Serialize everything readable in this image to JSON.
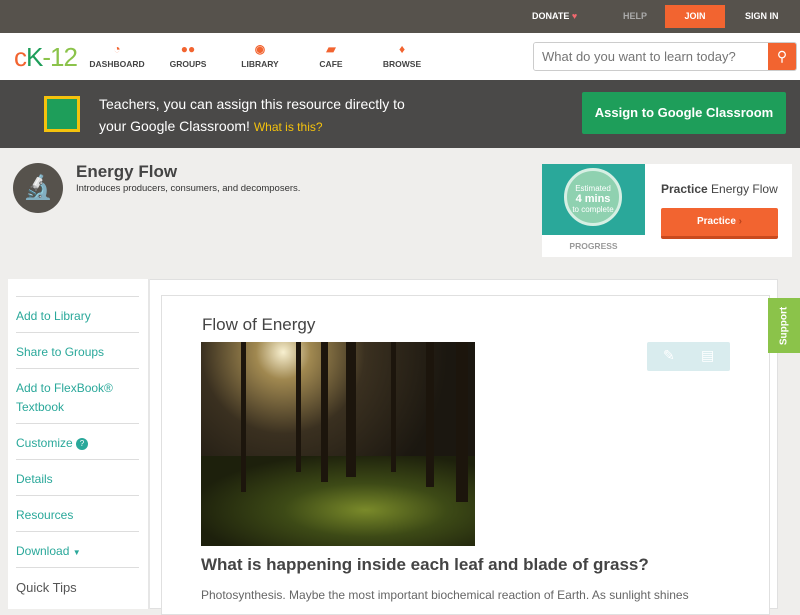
{
  "topbar": {
    "donate": "DONATE",
    "help": "HELP",
    "join": "JOIN",
    "signin": "SIGN IN"
  },
  "logo": {
    "text": "cK-12"
  },
  "nav": [
    {
      "label": "DASHBOARD",
      "icon": "dashboard-icon"
    },
    {
      "label": "GROUPS",
      "icon": "groups-icon"
    },
    {
      "label": "LIBRARY",
      "icon": "library-icon"
    },
    {
      "label": "CAFE",
      "icon": "cafe-icon"
    },
    {
      "label": "BROWSE",
      "icon": "browse-icon"
    }
  ],
  "search": {
    "placeholder": "What do you want to learn today?"
  },
  "banner": {
    "text": "Teachers, you can assign this resource directly to",
    "text2": "your Google Classroom!",
    "link": "What is this?",
    "button": "Assign to Google Classroom"
  },
  "header": {
    "title": "Energy Flow",
    "subtitle": "Introduces producers, consumers, and decomposers."
  },
  "practice": {
    "est1": "Estimated",
    "est2": "4 mins",
    "est3": "to complete",
    "progress": "PROGRESS",
    "bold": "Practice",
    "name": "Energy Flow",
    "button": "Practice"
  },
  "sidebar": {
    "items": [
      "Add to Library",
      "Share to Groups",
      "Add to FlexBook® Textbook",
      "Customize",
      "Details",
      "Resources",
      "Download",
      "Quick Tips"
    ]
  },
  "content": {
    "title": "Flow of Energy",
    "heading": "What is happening inside each leaf and blade of grass?",
    "paragraph": "Photosynthesis. Maybe the most important biochemical reaction of Earth. As sunlight shines"
  },
  "support": "Support",
  "colors": {
    "accent": "#f26430",
    "green": "#1e9e5a",
    "teal": "#2aa89a"
  }
}
